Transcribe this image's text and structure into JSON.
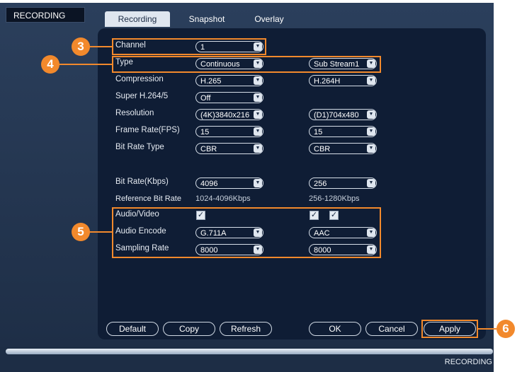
{
  "window": {
    "title": "RECORDING"
  },
  "tabs": [
    {
      "label": "Recording",
      "active": true
    },
    {
      "label": "Snapshot",
      "active": false
    },
    {
      "label": "Overlay",
      "active": false
    }
  ],
  "fields": {
    "channel": {
      "label": "Channel",
      "value": "1"
    },
    "type": {
      "label": "Type",
      "main": "Continuous",
      "sub": "Sub Stream1"
    },
    "compression": {
      "label": "Compression",
      "main": "H.265",
      "sub": "H.264H"
    },
    "super_h": {
      "label": "Super H.264/5",
      "main": "Off"
    },
    "resolution": {
      "label": "Resolution",
      "main": "(4K)3840x216",
      "sub": "(D1)704x480"
    },
    "frame_rate": {
      "label": "Frame Rate(FPS)",
      "main": "15",
      "sub": "15"
    },
    "bit_rate_type": {
      "label": "Bit Rate Type",
      "main": "CBR",
      "sub": "CBR"
    },
    "bit_rate": {
      "label": "Bit Rate(Kbps)",
      "main": "4096",
      "sub": "256"
    },
    "reference_bit_rate": {
      "label": "Reference Bit Rate",
      "main": "1024-4096Kbps",
      "sub": "256-1280Kbps"
    },
    "audio_video": {
      "label": "Audio/Video",
      "main_checked": true,
      "sub_checked": [
        true,
        true
      ]
    },
    "audio_encode": {
      "label": "Audio Encode",
      "main": "G.711A",
      "sub": "AAC"
    },
    "sampling_rate": {
      "label": "Sampling Rate",
      "main": "8000",
      "sub": "8000"
    }
  },
  "buttons": {
    "default": "Default",
    "copy": "Copy",
    "refresh": "Refresh",
    "ok": "OK",
    "cancel": "Cancel",
    "apply": "Apply"
  },
  "callouts": [
    "3",
    "4",
    "5",
    "6"
  ],
  "footer": {
    "text": "RECORDING"
  },
  "icons": {
    "dropdown": "chevron-down-icon",
    "check": "check-icon"
  },
  "colors": {
    "highlight": "#f2892c",
    "panel": "#0f1d35",
    "background": "#2b3f5c"
  }
}
